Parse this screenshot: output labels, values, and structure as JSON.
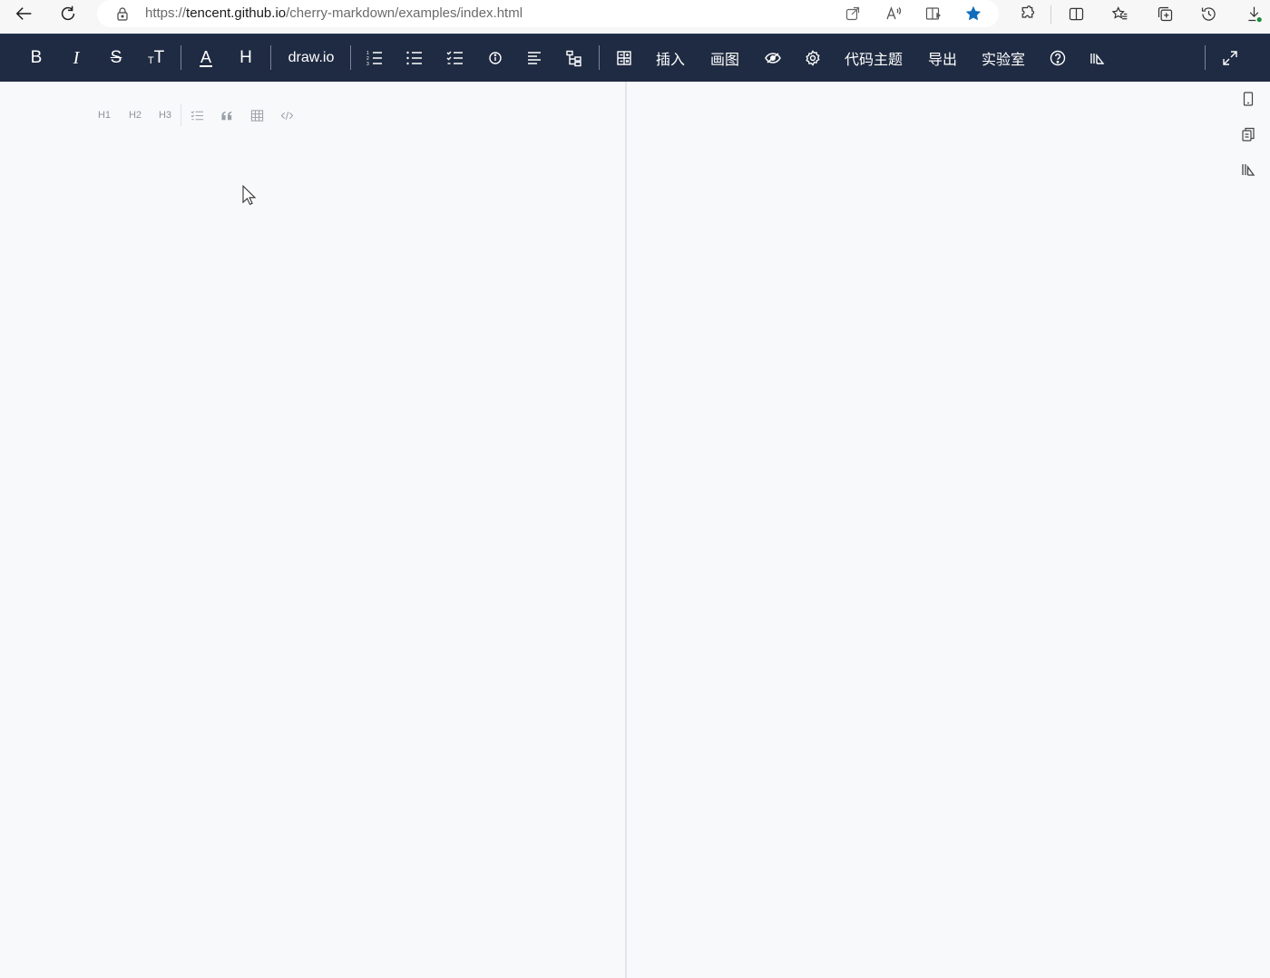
{
  "browser": {
    "url_prefix": "https://",
    "url_host": "tencent.github.io",
    "url_path": "/cherry-markdown/examples/index.html",
    "icons": [
      "back-arrow-icon",
      "refresh-icon",
      "lock-icon",
      "open-in-app-icon",
      "read-aloud-icon",
      "immersive-reader-icon",
      "favorite-star-icon",
      "extensions-icon",
      "split-screen-icon",
      "favorites-icon",
      "collections-icon",
      "history-icon",
      "downloads-icon"
    ],
    "accent": "#0f6cbd"
  },
  "toolbar": {
    "background": "#1f2b42",
    "bold": "B",
    "italic": "I",
    "strikethrough": "S",
    "size": "T",
    "color": "A",
    "header": "H",
    "drawio": "draw.io",
    "insert": "插入",
    "draw": "画图",
    "code_theme": "代码主题",
    "export": "导出",
    "lab": "实验室"
  },
  "float_menu": {
    "h1": "H1",
    "h2": "H2",
    "h3": "H3"
  }
}
